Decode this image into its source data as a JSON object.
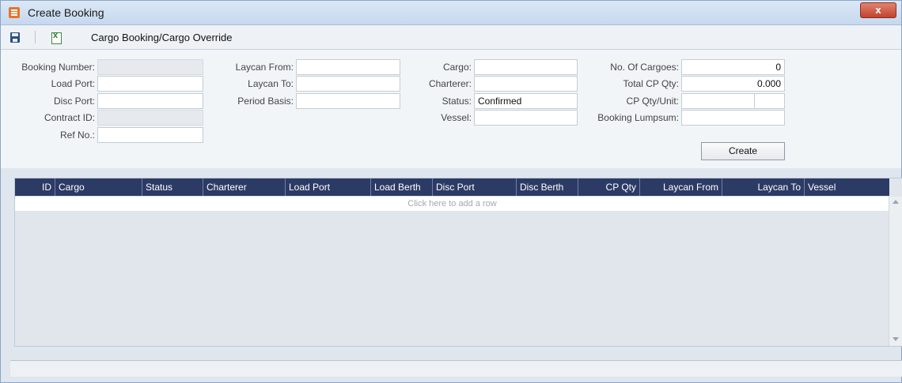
{
  "window": {
    "title": "Create Booking",
    "close_label": "x"
  },
  "toolbar": {
    "title": "Cargo Booking/Cargo Override"
  },
  "form": {
    "booking_number": {
      "label": "Booking Number:",
      "value": ""
    },
    "load_port": {
      "label": "Load Port:",
      "value": ""
    },
    "disc_port": {
      "label": "Disc Port:",
      "value": ""
    },
    "contract_id": {
      "label": "Contract ID:",
      "value": ""
    },
    "ref_no": {
      "label": "Ref No.:",
      "value": ""
    },
    "laycan_from": {
      "label": "Laycan From:",
      "value": ""
    },
    "laycan_to": {
      "label": "Laycan To:",
      "value": ""
    },
    "period_basis": {
      "label": "Period Basis:",
      "value": ""
    },
    "cargo": {
      "label": "Cargo:",
      "value": ""
    },
    "charterer": {
      "label": "Charterer:",
      "value": ""
    },
    "status": {
      "label": "Status:",
      "value": "Confirmed"
    },
    "vessel": {
      "label": "Vessel:",
      "value": ""
    },
    "no_of_cargoes": {
      "label": "No. Of Cargoes:",
      "value": "0"
    },
    "total_cp_qty": {
      "label": "Total CP Qty:",
      "value": "0.000"
    },
    "cp_qty_unit": {
      "label": "CP Qty/Unit:",
      "value": "",
      "unit": ""
    },
    "booking_lumpsum": {
      "label": "Booking Lumpsum:",
      "value": ""
    },
    "create_label": "Create"
  },
  "grid": {
    "columns": [
      "ID",
      "Cargo",
      "Status",
      "Charterer",
      "Load Port",
      "Load Berth",
      "Disc Port",
      "Disc Berth",
      "CP Qty",
      "Laycan From",
      "Laycan To",
      "Vessel"
    ],
    "add_row_text": "Click here to add a row",
    "rows": []
  },
  "status_bar": {
    "text": ""
  },
  "colors": {
    "grid_header": "#2c3b65",
    "close_button": "#c1432e",
    "app_icon": "#e8742a"
  }
}
